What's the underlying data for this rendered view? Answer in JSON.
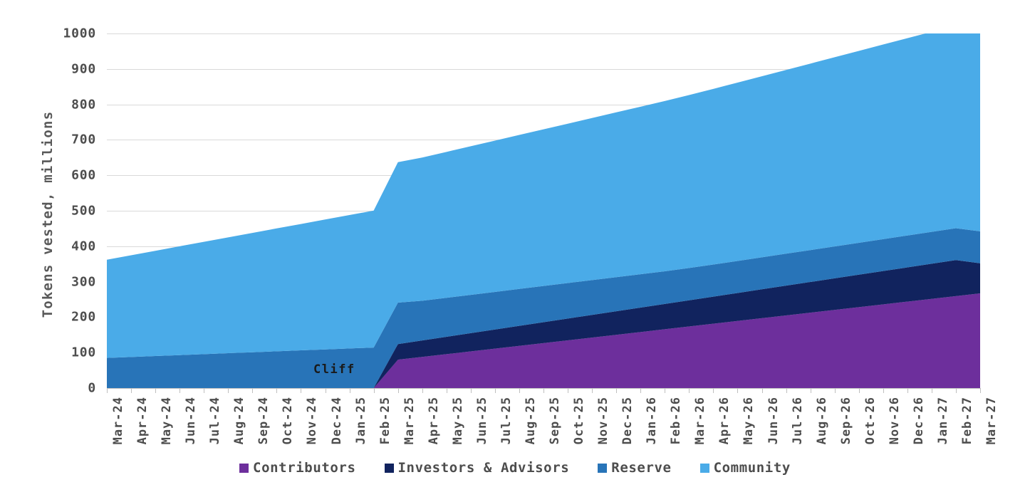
{
  "chart_data": {
    "type": "area",
    "stacked": true,
    "title": "",
    "subtitle": "",
    "xlabel": "",
    "ylabel": "Tokens vested, millions",
    "ylim": [
      0,
      1000
    ],
    "ytick_step": 100,
    "yticks": [
      0,
      100,
      200,
      300,
      400,
      500,
      600,
      700,
      800,
      900,
      1000
    ],
    "ytick_labels": [
      "0",
      "100",
      "200",
      "300",
      "400",
      "500",
      "600",
      "700",
      "800",
      "900",
      "1000"
    ],
    "grid": true,
    "legend_position": "bottom",
    "categories": [
      "Mar-24",
      "Apr-24",
      "May-24",
      "Jun-24",
      "Jul-24",
      "Aug-24",
      "Sep-24",
      "Oct-24",
      "Nov-24",
      "Dec-24",
      "Jan-25",
      "Feb-25",
      "Mar-25",
      "Apr-25",
      "May-25",
      "Jun-25",
      "Jul-25",
      "Aug-25",
      "Sep-25",
      "Oct-25",
      "Nov-25",
      "Dec-25",
      "Jan-26",
      "Feb-26",
      "Mar-26",
      "Apr-26",
      "May-26",
      "Jun-26",
      "Jul-26",
      "Aug-26",
      "Sep-26",
      "Oct-26",
      "Nov-26",
      "Dec-26",
      "Jan-27",
      "Feb-27",
      "Mar-27"
    ],
    "series": [
      {
        "name": "Contributors",
        "color": "#6d2f9c",
        "values": [
          0,
          0,
          0,
          0,
          0,
          0,
          0,
          0,
          0,
          0,
          0,
          0,
          80,
          87.8,
          95.6,
          103.4,
          111.2,
          119,
          126.8,
          134.6,
          142.4,
          150.2,
          158,
          165.8,
          173.6,
          181.4,
          189.2,
          197,
          204.8,
          212.6,
          220.4,
          228.2,
          236,
          243.8,
          251.6,
          259.4,
          267
        ]
      },
      {
        "name": "Investors & Advisors",
        "color": "#11235e",
        "values": [
          0,
          0,
          0,
          0,
          0,
          0,
          0,
          0,
          0,
          0,
          0,
          0,
          44,
          46.5,
          49,
          51.5,
          54,
          56.5,
          59,
          61.5,
          64,
          66.5,
          69,
          71.5,
          74,
          76.5,
          79,
          81.5,
          84,
          86.5,
          89,
          91.5,
          94,
          96.5,
          99,
          101.5,
          85
        ]
      },
      {
        "name": "Reserve",
        "color": "#2874b8",
        "values": [
          85,
          87.7,
          90.3,
          93,
          95.7,
          98.3,
          101,
          103.7,
          106.3,
          109,
          111.7,
          114.3,
          117,
          112,
          110,
          108,
          106,
          104,
          102,
          100,
          98,
          96,
          94,
          92,
          91,
          90.5,
          90.3,
          90.2,
          90.1,
          90,
          90,
          90,
          90,
          90,
          90,
          90,
          90
        ]
      },
      {
        "name": "Community",
        "color": "#4aabe8",
        "values": [
          277,
          286.9,
          296.8,
          306.8,
          316.7,
          326.6,
          336.5,
          346.5,
          356.4,
          366.3,
          376.2,
          386.2,
          396.1,
          403.7,
          411.4,
          419,
          426.6,
          434.3,
          441.9,
          449.5,
          457.2,
          464.8,
          472.4,
          480.1,
          487.7,
          495.3,
          503,
          510.6,
          518.2,
          525.9,
          533.5,
          541.1,
          548.8,
          556.4,
          564,
          571.7,
          558
        ]
      }
    ],
    "stacked_totals": [
      362,
      374.6,
      387.1,
      399.8,
      412.4,
      424.9,
      437.5,
      450.2,
      462.7,
      475.3,
      487.9,
      500.5,
      637.1,
      650,
      666,
      682,
      697.8,
      713.8,
      729.7,
      745.6,
      761.6,
      777.5,
      793.4,
      809.4,
      826.3,
      843.7,
      861.5,
      879.3,
      897.1,
      915,
      932.9,
      950.8,
      968.8,
      986.7,
      1004.6,
      1022.6,
      1000
    ],
    "annotations": [
      {
        "name": "cliff-region",
        "label": "Cliff",
        "color": "#bfbfbf",
        "x_start": "Mar-24",
        "x_end": "Mar-25",
        "y_start": 0,
        "y_end_start": 0,
        "y_end_end": 116
      }
    ],
    "legend": [
      {
        "label": "Contributors",
        "color": "#6d2f9c"
      },
      {
        "label": "Investors & Advisors",
        "color": "#11235e"
      },
      {
        "label": "Reserve",
        "color": "#2874b8"
      },
      {
        "label": "Community",
        "color": "#4aabe8"
      }
    ]
  }
}
